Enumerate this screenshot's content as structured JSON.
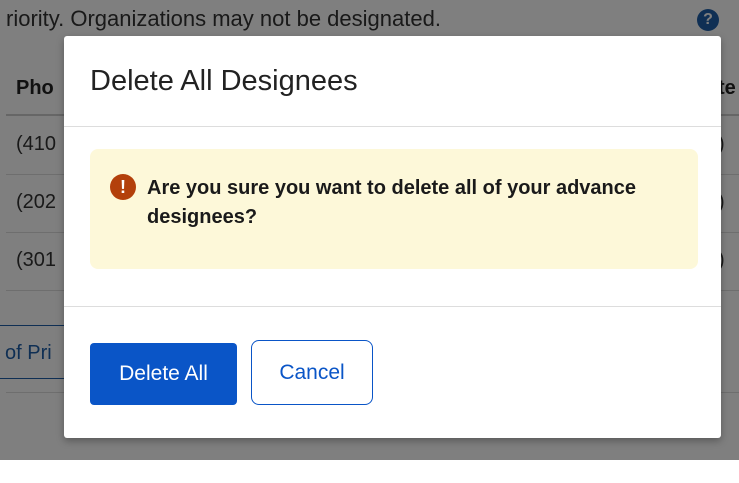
{
  "background": {
    "instructions": "riority.  Organizations may not be designated.",
    "help_icon": "?",
    "table_header_left": "Pho",
    "table_header_right": "te",
    "rows": [
      {
        "left": "(410",
        "right": ")"
      },
      {
        "left": "(202",
        "right": ")"
      },
      {
        "left": "(301",
        "right": ")"
      }
    ],
    "link_button": "of Pri"
  },
  "modal": {
    "title": "Delete All Designees",
    "alert": {
      "icon": "!",
      "icon_name": "exclamation-circle-icon",
      "message": "Are you sure you want to delete all of your advance designees?"
    },
    "buttons": {
      "delete_all": "Delete All",
      "cancel": "Cancel"
    }
  },
  "colors": {
    "primary": "#0a55c7",
    "alert_bg": "#fdf8d9",
    "alert_icon": "#b3400b",
    "overlay": "rgba(0,0,0,0.5)"
  }
}
